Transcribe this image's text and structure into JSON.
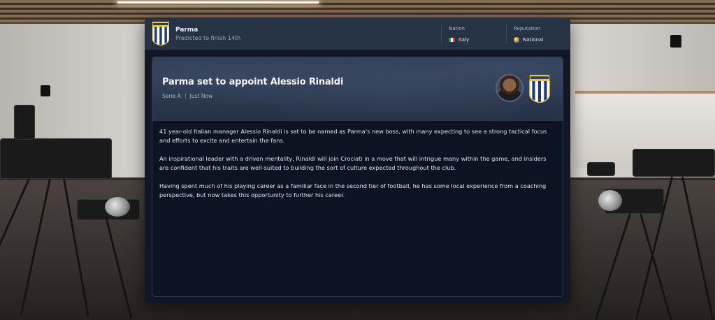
{
  "header": {
    "club_name": "Parma",
    "club_subtitle": "Predicted to finish 14th",
    "nation_label": "Nation",
    "nation_value": "Italy",
    "reputation_label": "Reputation",
    "reputation_value": "National"
  },
  "article": {
    "headline": "Parma set to appoint Alessio Rinaldi",
    "competition": "Serie A",
    "time": "Just Now",
    "paragraphs": [
      "41 year-old Italian manager Alessio Rinaldi is set to be named as Parma's new boss, with many expecting to see a strong tactical focus and efforts to excite and entertain the fans.",
      "An inspirational leader with a driven mentality, Rinaldi will join Crociati in a move that will intrigue many within the game, and insiders are confident that his traits are well-suited to building the sort of culture expected throughout the club.",
      "Having spent much of his playing career as a familiar face in the second tier of football, he  has some local experience from a coaching perspective, but now takes this opportunity to further his career."
    ]
  },
  "icons": {
    "club_crest": "parma-crest-icon",
    "nation_flag": "italy-flag-icon",
    "reputation": "reputation-globe-icon",
    "manager": "manager-avatar"
  },
  "colors": {
    "panel_bg": "#101828",
    "header_bg": "#263246",
    "crest_yellow": "#f2c230",
    "crest_blue": "#1c3d7a"
  }
}
